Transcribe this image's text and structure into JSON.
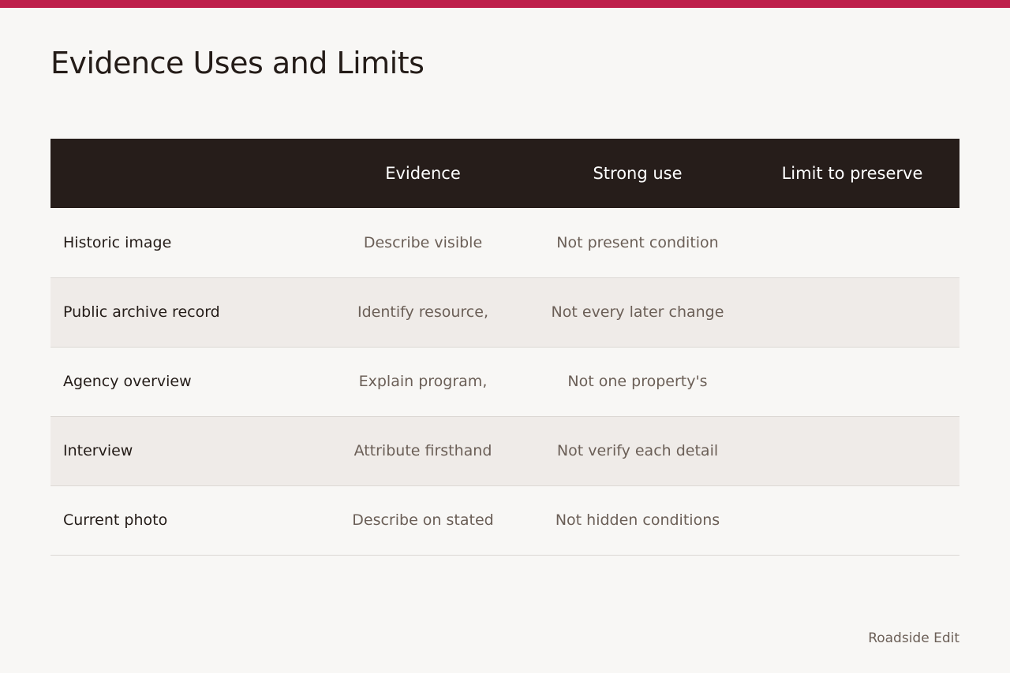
{
  "colors": {
    "accent": "#be1f4b",
    "header_bg": "#261d1a",
    "alt_row_bg": "#efebe8"
  },
  "title": "Evidence Uses and Limits",
  "table": {
    "headers": [
      "",
      "Evidence",
      "Strong use",
      "Limit to preserve"
    ],
    "rows": [
      {
        "label": "Historic image",
        "evidence": "Describe visible",
        "strong_use": "Not present condition",
        "limit": ""
      },
      {
        "label": "Public archive record",
        "evidence": "Identify resource,",
        "strong_use": "Not every later change",
        "limit": ""
      },
      {
        "label": "Agency overview",
        "evidence": "Explain program,",
        "strong_use": "Not one property's",
        "limit": ""
      },
      {
        "label": "Interview",
        "evidence": "Attribute firsthand",
        "strong_use": "Not verify each detail",
        "limit": ""
      },
      {
        "label": "Current photo",
        "evidence": "Describe on stated",
        "strong_use": "Not hidden conditions",
        "limit": ""
      }
    ]
  },
  "footer": {
    "credit": "Roadside Edit"
  }
}
